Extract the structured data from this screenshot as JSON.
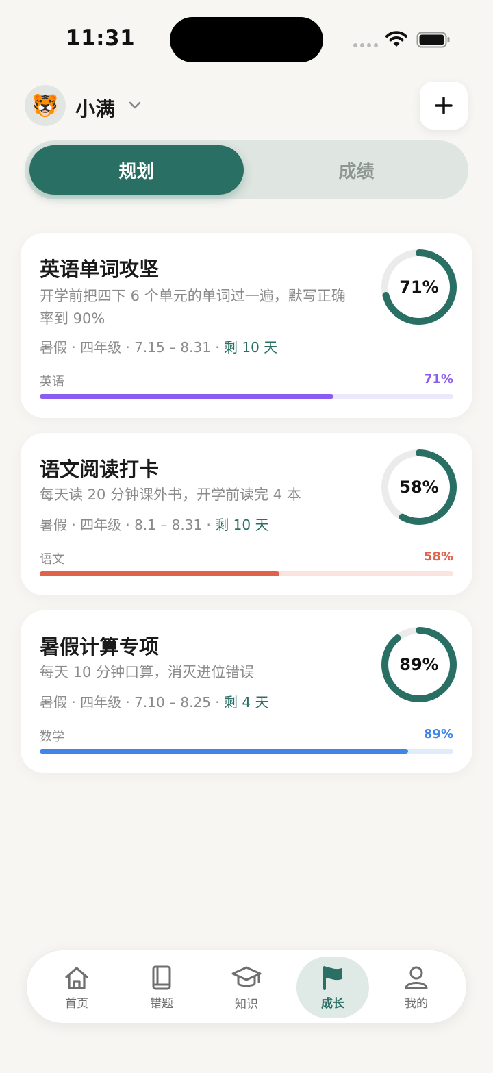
{
  "status_bar": {
    "time": "11:31"
  },
  "header": {
    "user_name": "小满",
    "avatar_emoji": "🐯"
  },
  "tabs": {
    "active": "规划",
    "inactive": "成绩"
  },
  "plans": [
    {
      "title": "英语单词攻坚",
      "description": "开学前把四下 6 个单元的单词过一遍，默写正确率到 90%",
      "meta": "暑假 · 四年级 · 7.15 – 8.31 · ",
      "remaining": "剩 10 天",
      "progress": 0.71,
      "progress_label": "71%",
      "subject": "英语",
      "color": "#8b5cf0",
      "track_color": "#ece8fb"
    },
    {
      "title": "语文阅读打卡",
      "description": "每天读 20 分钟课外书，开学前读完 4 本",
      "meta": "暑假 · 四年级 · 8.1 – 8.31 · ",
      "remaining": "剩 10 天",
      "progress": 0.58,
      "progress_label": "58%",
      "subject": "语文",
      "color": "#e0614c",
      "track_color": "#fbe3df"
    },
    {
      "title": "暑假计算专项",
      "description": "每天 10 分钟口算，消灭进位错误",
      "meta": "暑假 · 四年级 · 7.10 – 8.25 · ",
      "remaining": "剩 4 天",
      "progress": 0.89,
      "progress_label": "89%",
      "subject": "数学",
      "color": "#3f86e8",
      "track_color": "#e1ecfa"
    }
  ],
  "ring_color": "#2a6f64",
  "nav": [
    {
      "label": "首页",
      "icon": "home-icon"
    },
    {
      "label": "错题",
      "icon": "book-icon"
    },
    {
      "label": "知识",
      "icon": "graduation-cap-icon"
    },
    {
      "label": "成长",
      "icon": "flag-icon",
      "active": true
    },
    {
      "label": "我的",
      "icon": "person-icon"
    }
  ]
}
